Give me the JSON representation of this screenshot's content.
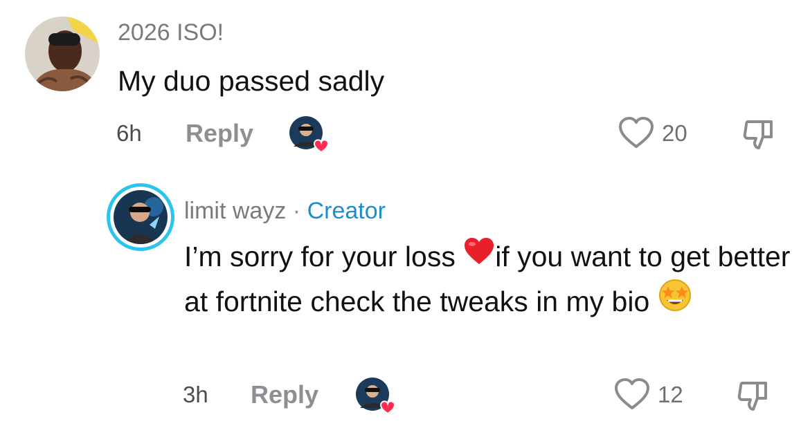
{
  "comments": [
    {
      "username": "2026 ISO!",
      "text": "My duo passed sadly",
      "time": "6h",
      "reply_label": "Reply",
      "like_count": "20",
      "icons": {
        "avatar": "user-avatar",
        "liked_by_creator": "creator-liked-avatar",
        "like": "heart-outline-icon",
        "dislike": "thumbs-down-icon"
      }
    },
    {
      "username": "limit wayz",
      "separator": "·",
      "badge": "Creator",
      "text_part1": "I’m sorry for your loss ",
      "text_part2": "if you want to get better at fortnite check the tweaks in my bio ",
      "time": "3h",
      "reply_label": "Reply",
      "like_count": "12",
      "icons": {
        "avatar": "creator-avatar",
        "emoji_heart": "red-heart-emoji",
        "emoji_star": "star-struck-emoji",
        "liked_by_creator": "creator-liked-avatar",
        "like": "heart-outline-icon",
        "dislike": "thumbs-down-icon"
      }
    }
  ],
  "colors": {
    "creator_ring": "#2cc4ec",
    "creator_badge": "#1f8ec8",
    "like_heart_badge": "#fe2c55"
  }
}
